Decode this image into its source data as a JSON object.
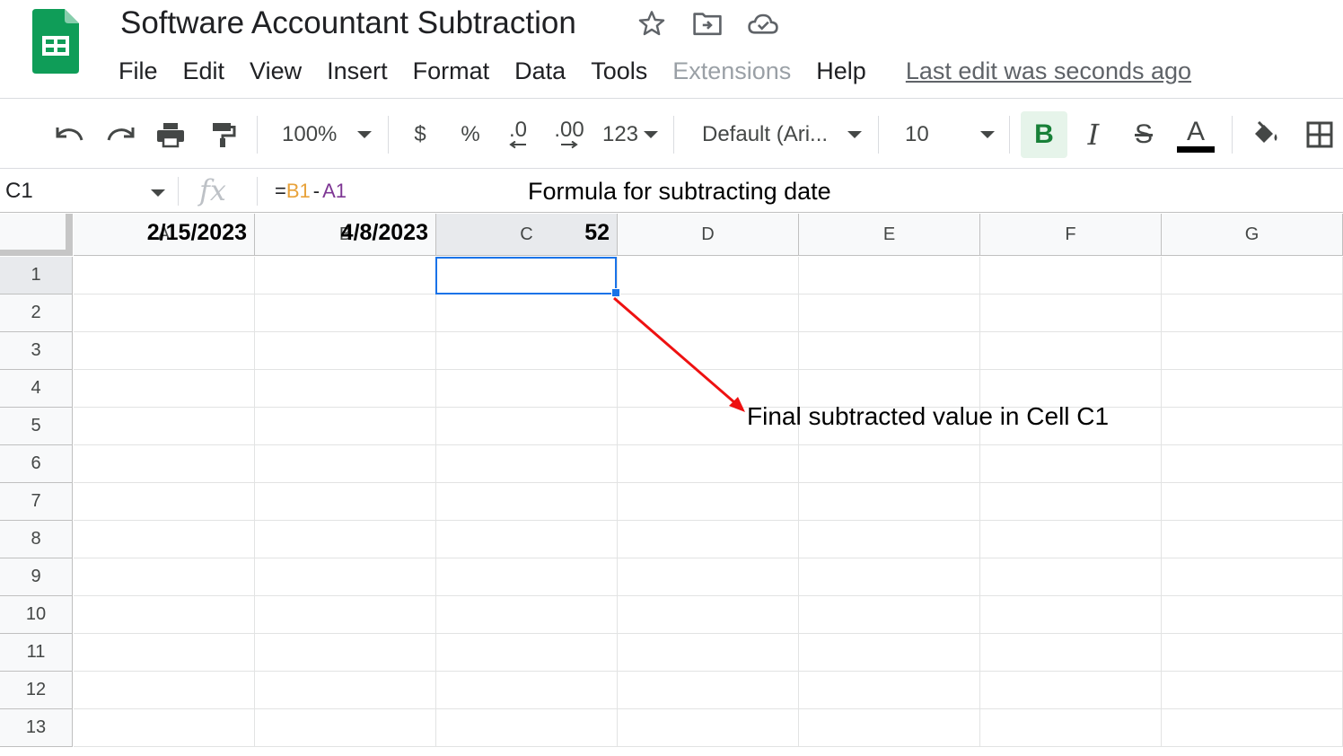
{
  "header": {
    "title": "Software Accountant Subtraction",
    "title_icons": [
      "star-icon",
      "move-to-folder-icon",
      "cloud-saved-icon"
    ],
    "menu": [
      {
        "label": "File",
        "disabled": false
      },
      {
        "label": "Edit",
        "disabled": false
      },
      {
        "label": "View",
        "disabled": false
      },
      {
        "label": "Insert",
        "disabled": false
      },
      {
        "label": "Format",
        "disabled": false
      },
      {
        "label": "Data",
        "disabled": false
      },
      {
        "label": "Tools",
        "disabled": false
      },
      {
        "label": "Extensions",
        "disabled": true
      },
      {
        "label": "Help",
        "disabled": false
      }
    ],
    "last_edit": "Last edit was seconds ago"
  },
  "toolbar": {
    "zoom": "100%",
    "currency": "$",
    "percent": "%",
    "decrease_decimal": ".0",
    "increase_decimal": ".00",
    "more_formats": "123",
    "font": "Default (Ari...",
    "font_size": "10",
    "bold_label": "B",
    "italic_label": "I",
    "strike_label": "S",
    "text_color_label": "A",
    "bold_active": true
  },
  "formula_bar": {
    "name_box": "C1",
    "fx": "fx",
    "formula": {
      "eq": "=",
      "ref1": "B1",
      "op": "-",
      "ref2": "A1"
    },
    "annotation": "Formula for subtracting date"
  },
  "grid": {
    "columns": [
      "A",
      "B",
      "C",
      "D",
      "E",
      "F",
      "G"
    ],
    "rows": [
      "1",
      "2",
      "3",
      "4",
      "5",
      "6",
      "7",
      "8",
      "9",
      "10",
      "11",
      "12",
      "13"
    ],
    "active_cell": "C1",
    "cells": {
      "A1": "2/15/2023",
      "B1": "4/8/2023",
      "C1": "52"
    },
    "annotation": "Final subtracted value in Cell C1"
  },
  "colors": {
    "accent": "#1a73e8",
    "sheets_green": "#0f9d58",
    "ref_orange": "#e8a23a",
    "ref_purple": "#7e3794",
    "annotation_arrow": "#ee1111"
  }
}
